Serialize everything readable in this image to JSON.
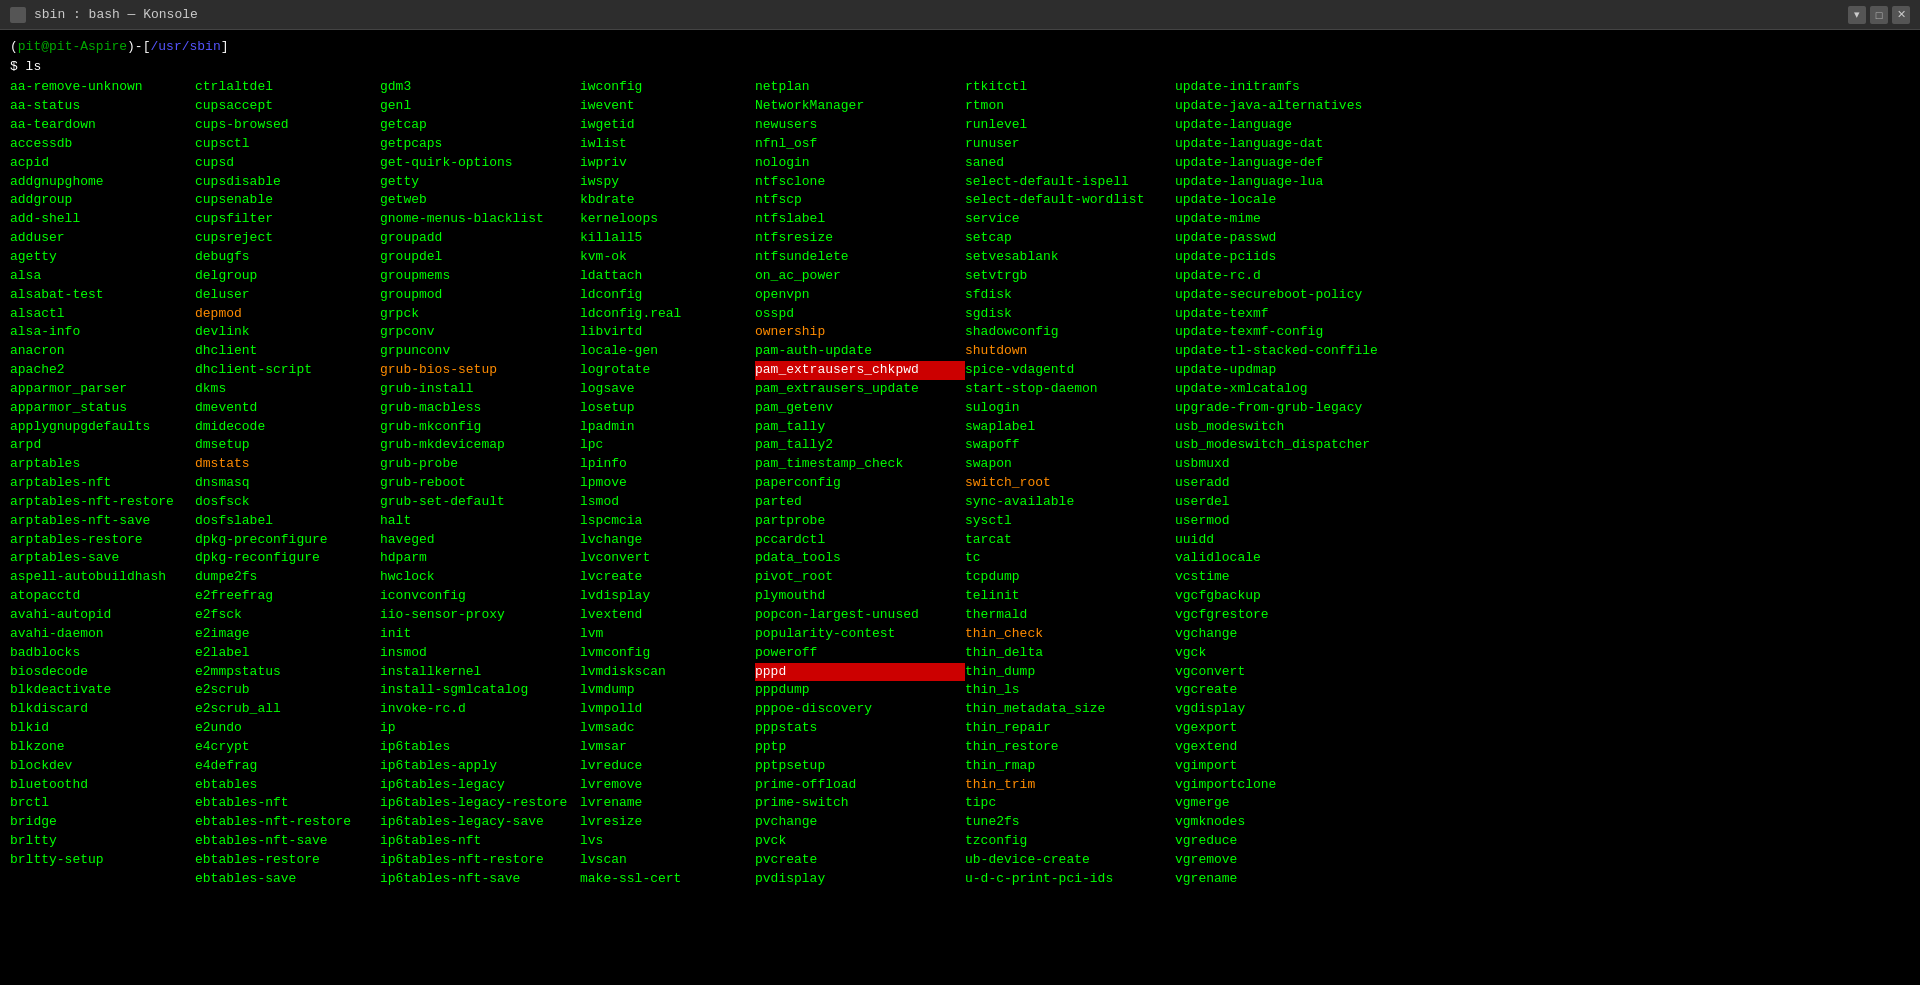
{
  "titleBar": {
    "title": "sbin : bash — Konsole",
    "iconLabel": "konsole-icon"
  },
  "promptLine1": {
    "bracket_open": "(",
    "user": "pit",
    "at": "@",
    "host": "pit-Aspire",
    "bracket_close": ")",
    "dash": "-",
    "sq_open": "[",
    "path": "/usr/sbin",
    "sq_close": "]"
  },
  "command": "ls",
  "columns": [
    [
      "aa-remove-unknown",
      "aa-status",
      "aa-teardown",
      "accessdb",
      "acpid",
      "addgnupghome",
      "addgroup",
      "add-shell",
      "adduser",
      "agetty",
      "alsa",
      "alsabat-test",
      "alsactl",
      "alsa-info",
      "anacron",
      "apache2",
      "apparmor_parser",
      "apparmor_status",
      "applygnupgdefaults",
      "arpd",
      "arptables",
      "arptables-nft",
      "arptables-nft-restore",
      "arptables-nft-save",
      "arptables-restore",
      "arptables-save",
      "aspell-autobuildhash",
      "atopacctd",
      "avahi-autopid",
      "avahi-daemon",
      "badblocks",
      "biosdecode",
      "blkdeactivate",
      "blkdiscard",
      "blkid",
      "blkzone",
      "blockdev",
      "bluetoothd",
      "brctl",
      "bridge",
      "brltty",
      "brltty-setup"
    ],
    [
      "ctrlaltdel",
      "cupsaccept",
      "cups-browsed",
      "cupsctl",
      "cupsd",
      "cupsdisable",
      "cupsenable",
      "cupsfilter",
      "cupsreject",
      "debugfs",
      "delgroup",
      "deluser",
      "depmod",
      "devlink",
      "dhclient",
      "dhclient-script",
      "dkms",
      "dmeventd",
      "dmidecode",
      "dmsetup",
      "dmstats",
      "dnsmasq",
      "dosfsck",
      "dosfslabel",
      "dpkg-preconfigure",
      "dpkg-reconfigure",
      "dumpe2fs",
      "e2freefrag",
      "e2fsck",
      "e2image",
      "e2label",
      "e2mmpstatus",
      "e2scrub",
      "e2scrub_all",
      "e2undo",
      "e4crypt",
      "e4defrag",
      "ebtables",
      "ebtables-nft",
      "ebtables-nft-restore",
      "ebtables-nft-save",
      "ebtables-restore",
      "ebtables-save"
    ],
    [
      "gdm3",
      "genl",
      "getcap",
      "getpcaps",
      "get-quirk-options",
      "getty",
      "getweb",
      "gnome-menus-blacklist",
      "groupadd",
      "groupdel",
      "groupmems",
      "groupmod",
      "grpck",
      "grpconv",
      "grpunconv",
      "grub-bios-setup",
      "grub-install",
      "grub-macbless",
      "grub-mkconfig",
      "grub-mkdevicemap",
      "grub-probe",
      "grub-reboot",
      "grub-set-default",
      "halt",
      "haveged",
      "hdparm",
      "hwclock",
      "iconv config",
      "iio-sensor-proxy",
      "init",
      "insmod",
      "installkernel",
      "install-sgmlcatalog",
      "invoke-rc.d",
      "ip",
      "ip6tables",
      "ip6tables-apply",
      "ip6tables-legacy",
      "ip6tables-legacy-restore",
      "ip6tables-legacy-save",
      "ip6tables-nft",
      "ip6tables-nft-restore",
      "ip6tables-nft-save"
    ],
    [
      "iwconfig",
      "iwevent",
      "iwgetid",
      "iwlist",
      "iwpriv",
      "iwspy",
      "kbdrate",
      "kerneloops",
      "killall5",
      "kvm-ok",
      "ldattach",
      "ldconfig",
      "ldconfig.real",
      "libvirtd",
      "locale-gen",
      "logrotate",
      "logsave",
      "losetup",
      "lpadmin",
      "lpc",
      "lpinfo",
      "lpmove",
      "lsmod",
      "lspcmcia",
      "lvchange",
      "lvconvert",
      "lvcreate",
      "lvdisplay",
      "lvextend",
      "lvm",
      "lvmconfig",
      "lvmdiskscan",
      "lvmdump",
      "lvmpolld",
      "lvmsadc",
      "lvmsar",
      "lvreduce",
      "lvremove",
      "lvrename",
      "lvresize",
      "lvs",
      "lvscan",
      "make-ssl-cert"
    ],
    [
      "netplan",
      "NetworkManager",
      "newusers",
      "nfnl_osf",
      "nologin",
      "ntfsclone",
      "ntfscp",
      "ntfslabel",
      "ntfsresize",
      "ntfsundelete",
      "on_ac_power",
      "openvpn",
      "osspd",
      "ownership",
      "pam-auth-update",
      "pam_extrausers_chkpwd",
      "pam_extrausers_update",
      "pam_getenv",
      "pam_tally",
      "pam_tally2",
      "pam_timestamp_check",
      "paperconfig",
      "parted",
      "partprobe",
      "pccardctl",
      "pdata_tools",
      "pivot_root",
      "plymouthd",
      "popcon-largest-unused",
      "popularity-contest",
      "poweroff",
      "pppd",
      "pppdump",
      "pppoe-discovery",
      "pppstats",
      "pptp",
      "pptpsetup",
      "prime-offload",
      "prime-switch",
      "pvchange",
      "pvck",
      "pvcreate",
      "pvdisplay"
    ],
    [
      "rtkitctl",
      "rtmon",
      "runlevel",
      "runuser",
      "saned",
      "select-default-ispell",
      "select-default-wordlist",
      "service",
      "setcap",
      "setvesablank",
      "setvtrgb",
      "sfdisk",
      "sgdisk",
      "shadowconfig",
      "shutdown",
      "spice-vdagentd",
      "start-stop-daemon",
      "sulogin",
      "swaplabel",
      "swapoff",
      "swapon",
      "switch_root",
      "sync-available",
      "sysctl",
      "tarcat",
      "tc",
      "tcpdump",
      "telinit",
      "thermald",
      "thin_check",
      "thin_delta",
      "thin_dump",
      "thin_ls",
      "thin_metadata_size",
      "thin_repair",
      "thin_restore",
      "thin_rmap",
      "thin_trim",
      "tipc",
      "tune2fs",
      "tzconfig",
      "ub-device-create",
      "u-d-c-print-pci-ids"
    ],
    [
      "update-initramfs",
      "update-java-alternatives",
      "update-language",
      "update-language-dat",
      "update-language-def",
      "update-language-lua",
      "update-locale",
      "update-mime",
      "update-passwd",
      "update-pciids",
      "update-rc.d",
      "update-secureboot-policy",
      "update-texmf",
      "update-texmf-config",
      "update-tl-stacked-conffile",
      "update-updmap",
      "update-xmlcatalog",
      "upgrade-from-grub-legacy",
      "usb_modeswitch",
      "usb_modeswitch_dispatcher",
      "usbmuxd",
      "useradd",
      "userdel",
      "usermod",
      "uuidd",
      "validlocale",
      "vcstime",
      "vgcfgbackup",
      "vgcfgrestore",
      "vgchange",
      "vgck",
      "vgconvert",
      "vgcreate",
      "vgdisplay",
      "vgexport",
      "vgextend",
      "vgimport",
      "vgimportclone",
      "vgmerge",
      "vgmknodes",
      "vgreduce",
      "vgremove",
      "vgrename"
    ]
  ],
  "highlightedItems": {
    "pam_extrausers_chkpwd": "red",
    "pppd": "red",
    "ownership": "orange",
    "shutdown": "orange",
    "thin_check": "orange",
    "thin_trim": "orange",
    "Switch root": "orange"
  },
  "orangeItems": [
    "depmod",
    "dmstats",
    "shutdown",
    "ownership",
    "thin_check",
    "thin_trim",
    "switch_root"
  ],
  "colors": {
    "bg": "#000000",
    "text": "#00ff00",
    "titleBg": "#2d2d2d",
    "orange": "#ff8c00",
    "red_highlight": "#cc0000",
    "orange_highlight": "#cc6600"
  }
}
